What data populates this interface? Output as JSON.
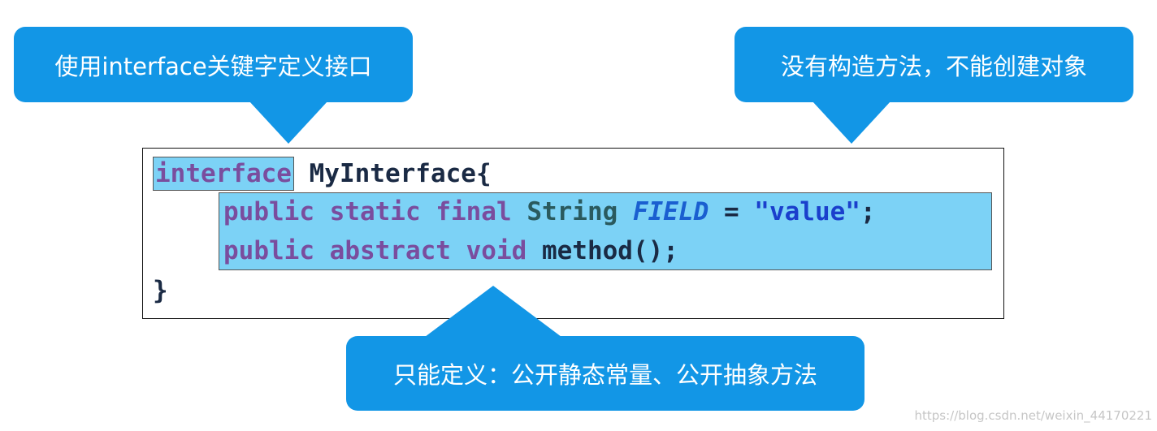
{
  "callouts": {
    "left": "使用interface关键字定义接口",
    "right": "没有构造方法，不能创建对象",
    "bottom": "只能定义：公开静态常量、公开抽象方法"
  },
  "code": {
    "line1": {
      "keyword": "interface",
      "name": " MyInterface{"
    },
    "line2": {
      "public": "public",
      "static": "static",
      "final": "final",
      "type": "String",
      "field": "FIELD",
      "equals": " = ",
      "value": "\"value\"",
      "end": ";"
    },
    "line3": {
      "public": "public",
      "abstract": "abstract",
      "void": "void",
      "method": "method();"
    },
    "line4": "}"
  },
  "watermark": "https://blog.csdn.net/weixin_44170221",
  "colors": {
    "callout": "#1296e6",
    "highlight": "#7cd2f6",
    "keyword": "#7a4d9e"
  }
}
